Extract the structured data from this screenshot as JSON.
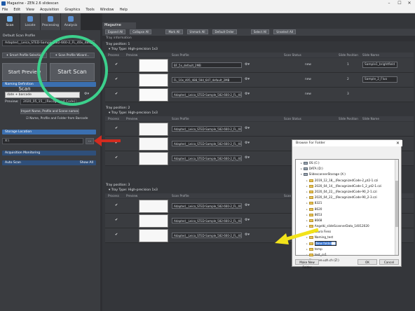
{
  "window": {
    "title": "Magazine - ZEN 2.6 slidescan",
    "controls": [
      "–",
      "☐",
      "✕"
    ]
  },
  "menu": [
    "File",
    "Edit",
    "View",
    "Acquisition",
    "Graphics",
    "Tools",
    "Window",
    "Help"
  ],
  "left_tabs": [
    {
      "label": "Scan"
    },
    {
      "label": "Locate"
    },
    {
      "label": "Processing"
    },
    {
      "label": "Analysis"
    }
  ],
  "left": {
    "profile_header": "Default Scan Profile",
    "profile_value": "Adapted__Leica_STED-Sample_582-660-2_FL_40x_488_555_2ZMB",
    "smart_btn": "Smart Profile Selection",
    "scan_wizard_btn": "Scan Profile Wizard...",
    "start_preview_btn": "Start Preview Scan",
    "start_scan_btn": "Start Scan",
    "naming_hdr": "Naming Definition",
    "naming_field": "date + barcode",
    "preview_label": "Preview:",
    "preview_value": "2020_05_15__(Recognized Code)",
    "import_btn": "Import Name, Profile and Scene names",
    "barcode_chk": "Name, Profile and Folder from Barcode",
    "storage_hdr": "Storage Location",
    "storage_path": "X:\\",
    "browse_btn": "...",
    "acq_hdr": "Acquisition Monitoring",
    "auto_hdr": "Auto Scan",
    "show_all": "Show All"
  },
  "right": {
    "tab": "Magazine",
    "toolbar": [
      "Expand All",
      "Collapse All",
      "Mark All",
      "Unmark All",
      "Default Order",
      "Select All",
      "Unselect All"
    ],
    "tray_info": "Tray information",
    "col_headers": [
      "Process",
      "Preview",
      "Scan Profile",
      "Scan Status",
      "Slide Position",
      "Slide Name"
    ],
    "trays": [
      {
        "position": "Tray position: 1",
        "type": "Tray Type:  High-precision 1x3",
        "slots": [
          {
            "checked": true,
            "preview": true,
            "profile": "BF_5x_default_2MB",
            "status": "new",
            "pos": "1",
            "name": "Sample1_brightfield"
          },
          {
            "checked": true,
            "preview": true,
            "profile": "FL_10x_405_488_594_647_default_2MB",
            "status": "new",
            "pos": "2",
            "name": "Sample_2_Fluo"
          },
          {
            "checked": true,
            "preview": true,
            "profile": "Adapted__Leica_STED-Sample_582-660-2_FL_40x_488_555_2MB",
            "status": "new",
            "pos": "3",
            "name": ""
          }
        ]
      },
      {
        "position": "Tray position: 2",
        "type": "Tray Type:  High-precision 1x3",
        "slots": [
          {
            "checked": true,
            "preview": false,
            "profile": "Adapted__Leica_STED-Sample_582-660-2_FL_40x_488_555_2MB",
            "status": "",
            "pos": "",
            "name": ""
          },
          {
            "checked": true,
            "preview": false,
            "profile": "Adapted__Leica_STED-Sample_582-660-2_FL_40x_488_555_2MB",
            "status": "",
            "pos": "",
            "name": ""
          },
          {
            "checked": true,
            "preview": false,
            "profile": "Adapted__Leica_STED-Sample_582-660-2_FL_40x_488_555_2MB",
            "status": "",
            "pos": "",
            "name": ""
          }
        ]
      },
      {
        "position": "Tray position: 3",
        "type": "Tray Type:  High-precision 1x3",
        "slots": [
          {
            "checked": true,
            "preview": false,
            "profile": "Adapted__Leica_STED-Sample_582-660-2_FL_40x_488_555_2MB",
            "status": "",
            "pos": "",
            "name": ""
          },
          {
            "checked": true,
            "preview": false,
            "profile": "Adapted__Leica_STED-Sample_582-660-2_FL_40x_488_555_2MB",
            "status": "",
            "pos": "",
            "name": ""
          },
          {
            "checked": true,
            "preview": false,
            "profile": "Adapted__Leica_STED-Sample_582-660-2_FL_40x_488_555_2MB",
            "status": "",
            "pos": "",
            "name": ""
          }
        ]
      }
    ]
  },
  "dialog": {
    "title": "Browse For Folder",
    "close": "✕",
    "tree": [
      {
        "label": "OS (C:)",
        "type": "drive",
        "level": 0
      },
      {
        "label": "DATA (D:)",
        "type": "drive",
        "level": 0
      },
      {
        "label": "SlidescannerStorage (X:)",
        "type": "drive",
        "level": 0
      },
      {
        "label": "2019_12_18__(RecognizedCode-2_pt2-1.czi",
        "type": "folder",
        "level": 1
      },
      {
        "label": "2020_04_14__(RecognizedCode-1_2_pt2-1.czi",
        "type": "folder",
        "level": 1
      },
      {
        "label": "2020_04_22__(RecognizedCode-90_2-1.czi",
        "type": "folder",
        "level": 1
      },
      {
        "label": "2020_04_22__(RecognizedCode-90_2-3.czi",
        "type": "folder",
        "level": 1
      },
      {
        "label": "8321",
        "type": "folder",
        "level": 1
      },
      {
        "label": "8620",
        "type": "folder",
        "level": 1
      },
      {
        "label": "8653",
        "type": "folder",
        "level": 1
      },
      {
        "label": "8668",
        "type": "folder",
        "level": 1
      },
      {
        "label": "Angelki_slideScannerData_14012020",
        "type": "folder",
        "level": 1
      },
      {
        "label": "Laura Fiess",
        "type": "folder",
        "level": 1
      },
      {
        "label": "Naming_test",
        "type": "folder",
        "level": 1
      },
      {
        "label": "New folder",
        "type": "folder",
        "level": 1,
        "editing": true
      },
      {
        "label": "temp",
        "type": "folder",
        "level": 1
      },
      {
        "label": "test_cs1",
        "type": "folder",
        "level": 1
      },
      {
        "label": "files.core.uzh.ch (Z:)",
        "type": "drive",
        "level": 0
      }
    ],
    "make_folder_btn": "Make New Folder",
    "ok_btn": "OK",
    "cancel_btn": "Cancel"
  },
  "annotations": {
    "circle_color": "#3cd08c",
    "red_arrow_color": "#d22b1f",
    "yellow_arrow_color": "#f2e31a"
  }
}
